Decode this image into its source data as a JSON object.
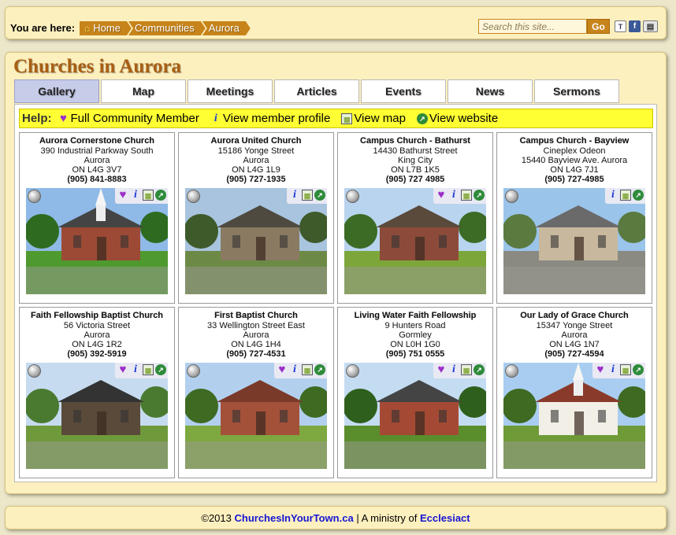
{
  "breadcrumb": {
    "label": "You are here:",
    "items": [
      "Home",
      "Communities",
      "Aurora"
    ]
  },
  "search": {
    "placeholder": "Search this site...",
    "button_label": "Go"
  },
  "page_title": "Churches in Aurora",
  "tabs": [
    {
      "label": "Gallery",
      "active": true
    },
    {
      "label": "Map",
      "active": false
    },
    {
      "label": "Meetings",
      "active": false
    },
    {
      "label": "Articles",
      "active": false
    },
    {
      "label": "Events",
      "active": false
    },
    {
      "label": "News",
      "active": false
    },
    {
      "label": "Sermons",
      "active": false
    }
  ],
  "help": {
    "label": "Help:",
    "items": [
      {
        "icon": "heart-icon",
        "label": "Full Community Member"
      },
      {
        "icon": "info-icon",
        "label": "View member profile"
      },
      {
        "icon": "map-icon",
        "label": "View map"
      },
      {
        "icon": "website-icon",
        "label": "View website"
      }
    ]
  },
  "churches": [
    {
      "name": "Aurora Cornerstone Church",
      "lines": [
        "390 Industrial Parkway South",
        "Aurora",
        "ON   L4G 3V7"
      ],
      "phone": "(905) 841-8883",
      "member": true
    },
    {
      "name": "Aurora United Church",
      "lines": [
        "15186 Yonge Street",
        "Aurora",
        "ON   L4G 1L9"
      ],
      "phone": "(905) 727-1935",
      "member": false
    },
    {
      "name": "Campus Church - Bathurst",
      "lines": [
        "14430 Bathurst Street",
        "King City",
        "ON   L7B 1K5"
      ],
      "phone": "(905) 727 4985",
      "member": true
    },
    {
      "name": "Campus Church - Bayview",
      "lines": [
        "Cineplex Odeon",
        "15440 Bayview Ave.   Aurora",
        "ON   L4G 7J1"
      ],
      "phone": "(905) 727-4985",
      "member": false
    },
    {
      "name": "Faith Fellowship Baptist Church",
      "lines": [
        "56 Victoria Street",
        "Aurora",
        "ON   L4G 1R2"
      ],
      "phone": "(905) 392-5919",
      "member": true
    },
    {
      "name": "First Baptist Church",
      "lines": [
        "33 Wellington Street East",
        "Aurora",
        "ON   L4G 1H4"
      ],
      "phone": "(905) 727-4531",
      "member": true
    },
    {
      "name": "Living Water Faith Fellowship",
      "lines": [
        "9 Hunters Road",
        "Gormley",
        "ON   L0H 1G0"
      ],
      "phone": "(905) 751 0555",
      "member": true
    },
    {
      "name": "Our Lady of Grace Church",
      "lines": [
        "15347 Yonge Street",
        "Aurora",
        "ON   L4G 1N7"
      ],
      "phone": "(905) 727-4594",
      "member": true
    }
  ],
  "footer": {
    "copyright": "©2013",
    "site_link": "ChurchesInYourTown.ca",
    "separator": "| A ministry of",
    "ministry_link": "Ecclesiact"
  },
  "colors": {
    "page_bg": "#ece7c9",
    "panel_bg": "#fdf0bf",
    "accent": "#c7841a",
    "title": "#a85f14",
    "help_bg": "#ffff33",
    "link": "#1616d4",
    "active_tab": "#c7cde9"
  }
}
